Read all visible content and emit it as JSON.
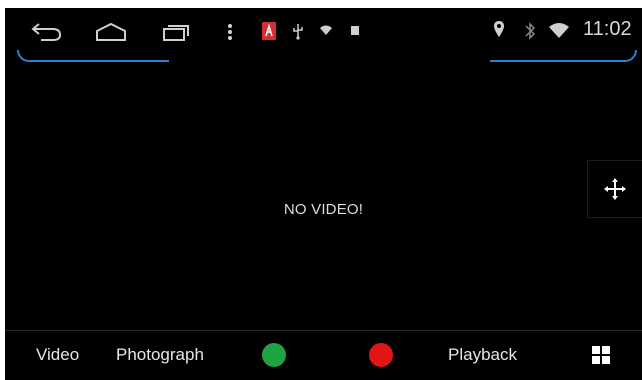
{
  "statusbar": {
    "time": "11:02",
    "left_icons": [
      "back-icon",
      "home-icon",
      "recent-apps-icon",
      "menu-dots-icon",
      "notification-app-icon",
      "usb-icon",
      "wifi-small-icon",
      "square-icon"
    ],
    "right_icons": [
      "location-icon",
      "bluetooth-icon",
      "wifi-icon"
    ],
    "accent_color": "#2a7fd6"
  },
  "main": {
    "message": "NO VIDEO!",
    "move_icon": "move-icon"
  },
  "bottombar": {
    "video_label": "Video",
    "photograph_label": "Photograph",
    "green_button_color": "#1fa343",
    "red_button_color": "#e01515",
    "playback_label": "Playback",
    "grid_icon": "grid-icon"
  }
}
